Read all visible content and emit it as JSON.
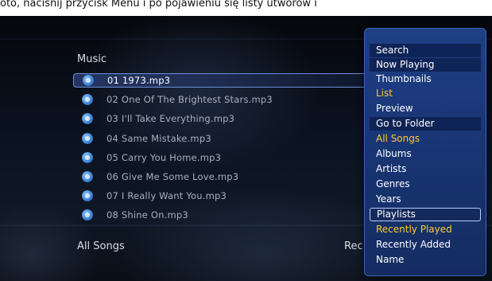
{
  "caption": "oto, naciśnij przycisk Menu i po pojawieniu się listy utworów i",
  "screen": {
    "title": "Music",
    "songs": [
      "01 1973.mp3",
      "02 One Of The Brightest Stars.mp3",
      "03 I'll Take Everything.mp3",
      "04 Same Mistake.mp3",
      "05 Carry You Home.mp3",
      "06 Give Me Some Love.mp3",
      "07 I Really Want You.mp3",
      "08 Shine On.mp3"
    ],
    "selected_song_index": 0,
    "bottom_left": "All Songs",
    "bottom_right": "Rec"
  },
  "menu": {
    "items": [
      "Search",
      "Now Playing",
      "Thumbnails",
      "List",
      "Preview",
      "Go to Folder",
      "All Songs",
      "Albums",
      "Artists",
      "Genres",
      "Years",
      "Playlists",
      "Recently Played",
      "Recently Added",
      "Name"
    ],
    "highlighted_items": [
      "List",
      "All Songs",
      "Recently Played"
    ],
    "focused_item": "Playlists"
  },
  "colors": {
    "menu_background": "#1f3f86",
    "highlight_text": "#ffcc2b",
    "focus_border": "#b4d2ff",
    "icon": "#3a7fd0"
  },
  "icons": {
    "song": "music-note-disc-icon"
  }
}
